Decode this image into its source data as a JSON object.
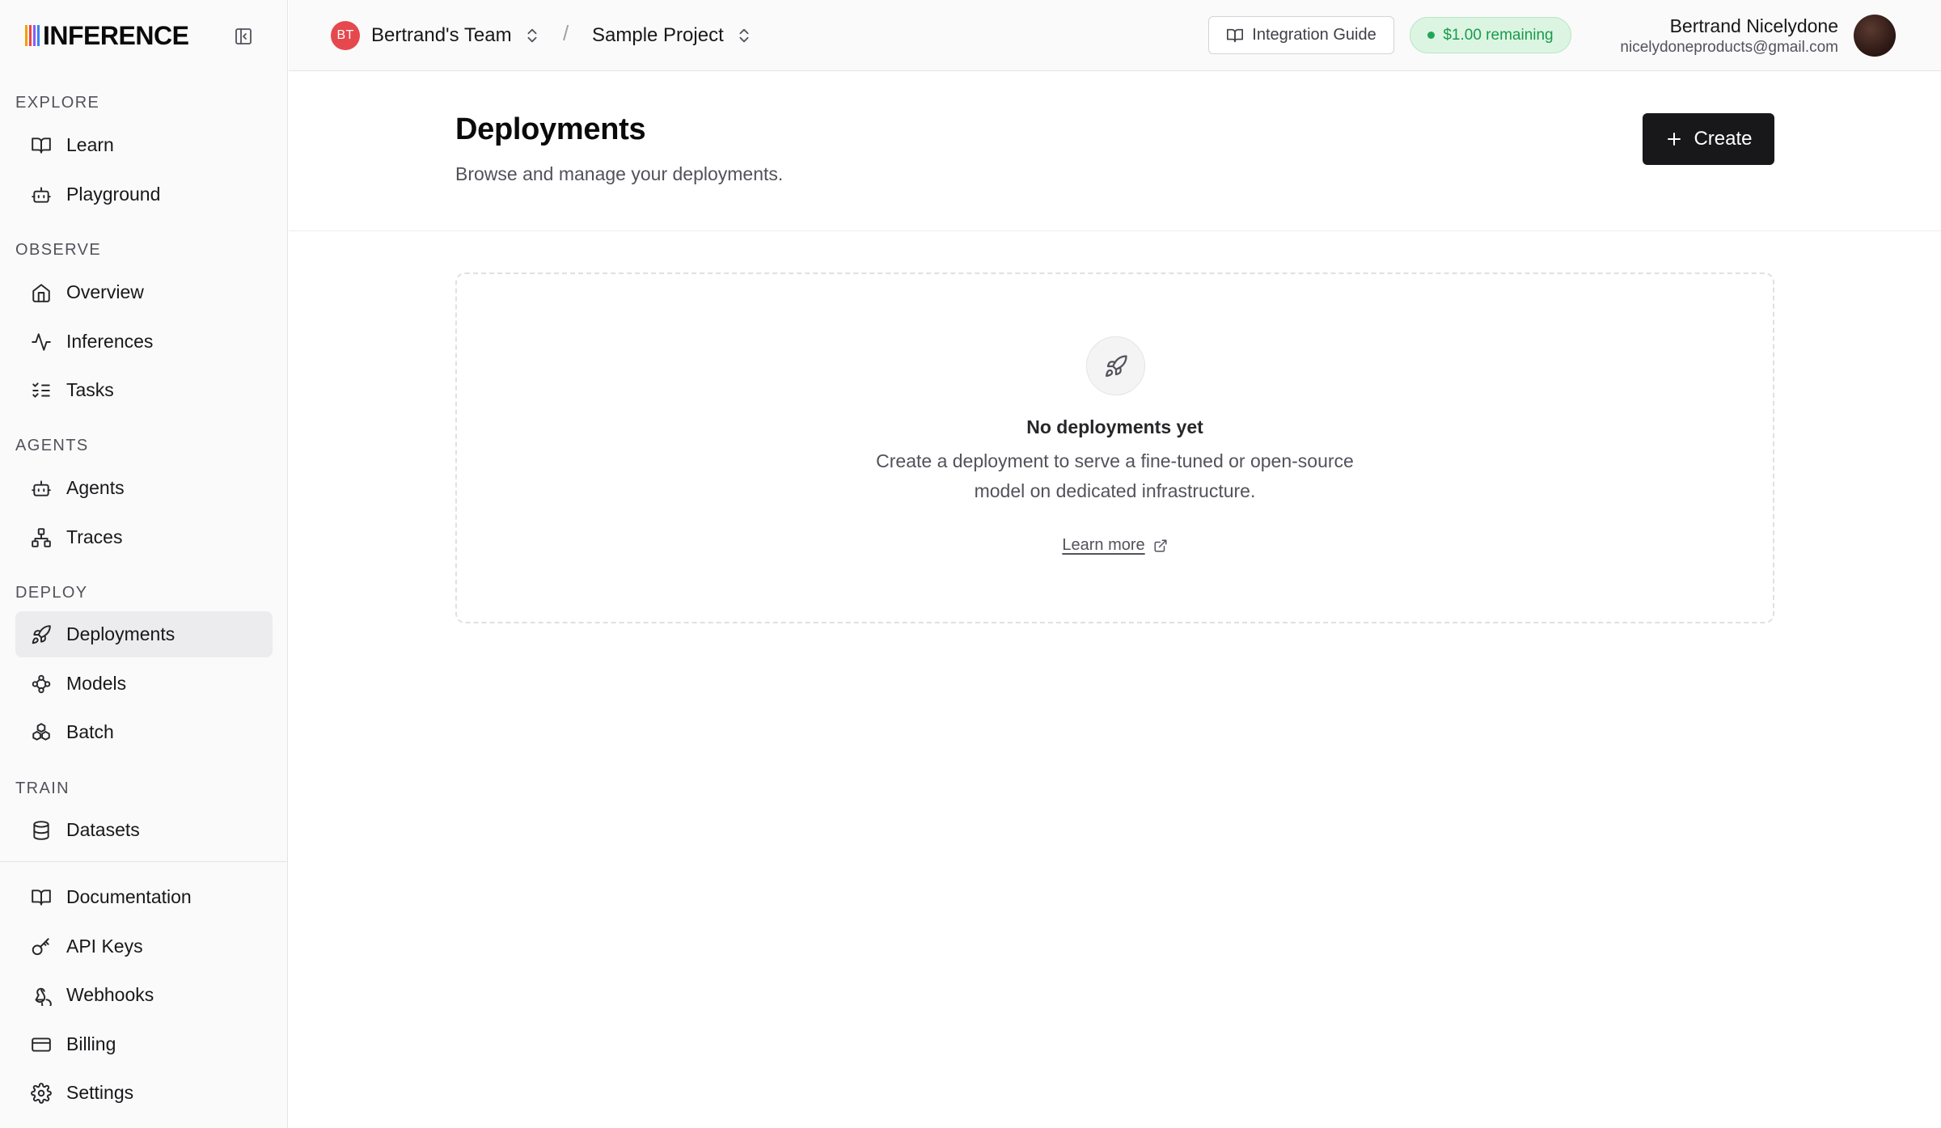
{
  "brand": {
    "name": "INFERENCE",
    "bar_colors": [
      "#f59e0b",
      "#ef4444",
      "#8b5cf6",
      "#3b82f6",
      "#10b981"
    ]
  },
  "sidebar": {
    "sections": [
      {
        "label": "EXPLORE"
      },
      {
        "label": "OBSERVE"
      },
      {
        "label": "AGENTS"
      },
      {
        "label": "DEPLOY"
      },
      {
        "label": "TRAIN"
      }
    ],
    "items": [
      {
        "label": "Learn",
        "icon": "book-open-icon"
      },
      {
        "label": "Playground",
        "icon": "bot-icon"
      },
      {
        "label": "Overview",
        "icon": "home-icon"
      },
      {
        "label": "Inferences",
        "icon": "activity-icon"
      },
      {
        "label": "Tasks",
        "icon": "list-checks-icon"
      },
      {
        "label": "Agents",
        "icon": "bot-icon"
      },
      {
        "label": "Traces",
        "icon": "network-icon"
      },
      {
        "label": "Deployments",
        "icon": "rocket-icon",
        "active": true
      },
      {
        "label": "Models",
        "icon": "models-icon"
      },
      {
        "label": "Batch",
        "icon": "boxes-icon"
      },
      {
        "label": "Datasets",
        "icon": "database-icon"
      }
    ],
    "footer_items": [
      {
        "label": "Documentation",
        "icon": "book-open-icon"
      },
      {
        "label": "API Keys",
        "icon": "key-icon"
      },
      {
        "label": "Webhooks",
        "icon": "webhook-icon"
      },
      {
        "label": "Billing",
        "icon": "credit-card-icon"
      },
      {
        "label": "Settings",
        "icon": "gear-icon"
      }
    ]
  },
  "header": {
    "team": {
      "initials": "BT",
      "name": "Bertrand's Team",
      "avatar_color": "#e5484d"
    },
    "separator": "/",
    "project": {
      "name": "Sample Project"
    },
    "integration_guide": "Integration Guide",
    "credits": "$1.00 remaining",
    "user": {
      "name": "Bertrand Nicelydone",
      "email": "nicelydoneproducts@gmail.com"
    }
  },
  "page": {
    "title": "Deployments",
    "subtitle": "Browse and manage your deployments.",
    "create_label": "Create",
    "empty": {
      "title": "No deployments yet",
      "description": "Create a deployment to serve a fine-tuned or open-source model on dedicated infrastructure.",
      "link": "Learn more"
    }
  }
}
